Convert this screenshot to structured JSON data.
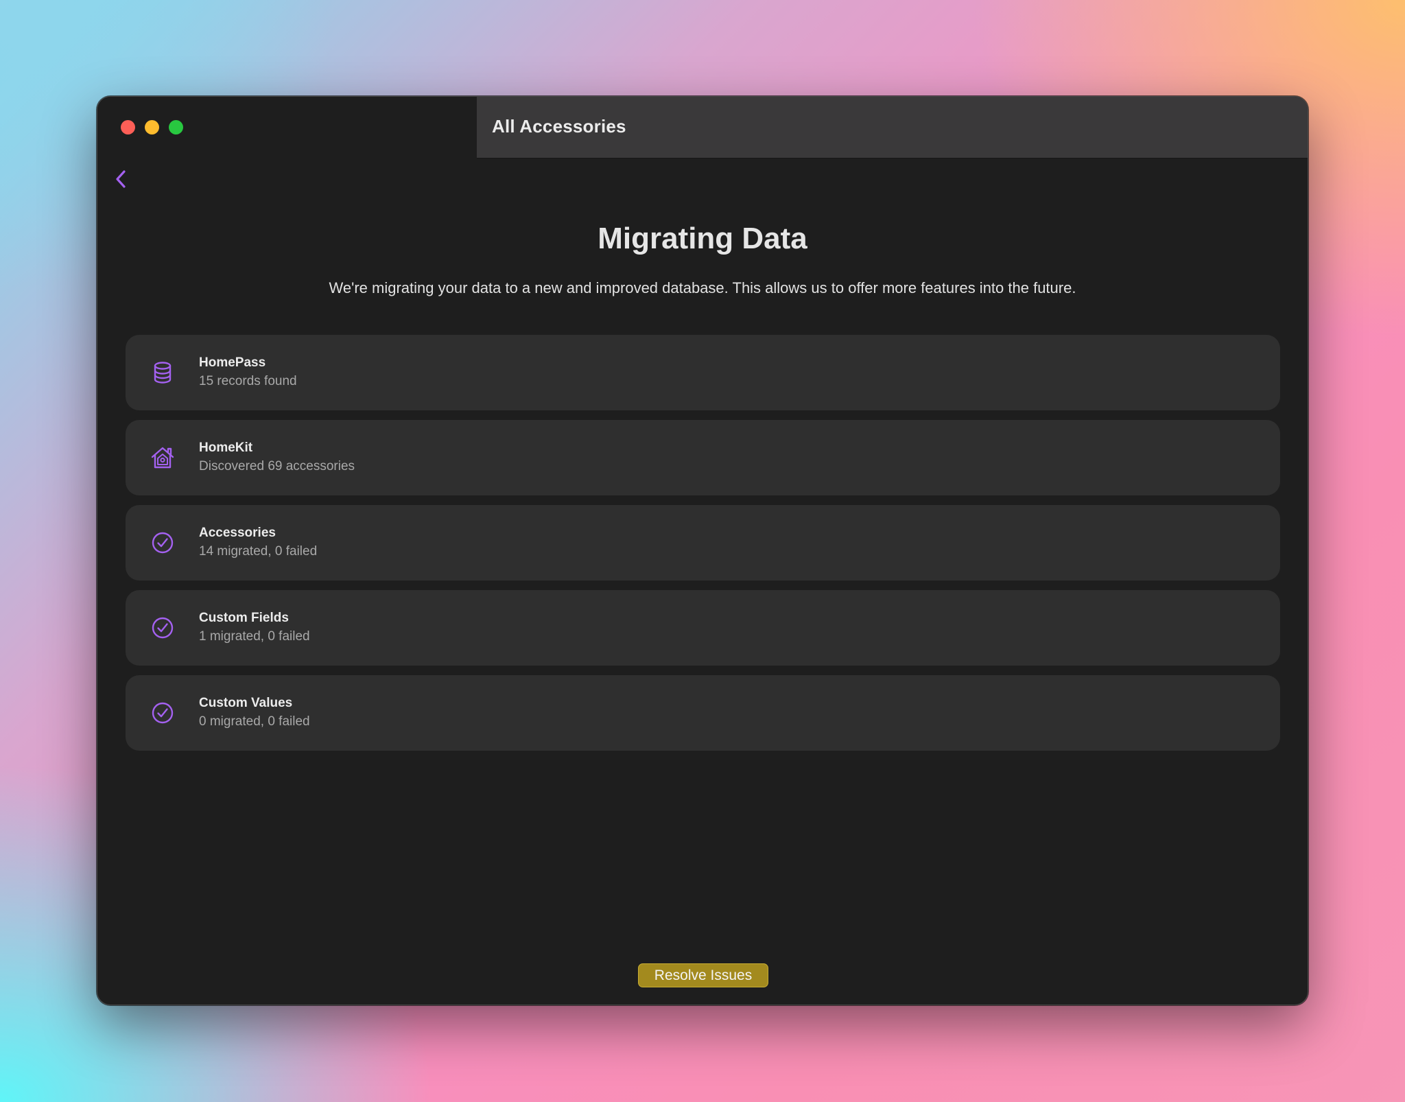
{
  "window": {
    "title": "All Accessories"
  },
  "main": {
    "heading": "Migrating Data",
    "description": "We're migrating your data to a new and improved database. This allows us to offer more features into the future.",
    "items": [
      {
        "icon": "database-icon",
        "title": "HomePass",
        "detail": "15 records found"
      },
      {
        "icon": "home-icon",
        "title": "HomeKit",
        "detail": "Discovered 69 accessories"
      },
      {
        "icon": "checkmark-circle-icon",
        "title": "Accessories",
        "detail": "14 migrated, 0 failed"
      },
      {
        "icon": "checkmark-circle-icon",
        "title": "Custom Fields",
        "detail": "1 migrated, 0 failed"
      },
      {
        "icon": "checkmark-circle-icon",
        "title": "Custom Values",
        "detail": "0 migrated, 0 failed"
      }
    ],
    "resolve_label": "Resolve Issues"
  },
  "colors": {
    "accent": "#a461f0",
    "resolve_button": "#a38a1e",
    "card_background": "#2f2f2f",
    "window_background": "#1e1e1e"
  }
}
